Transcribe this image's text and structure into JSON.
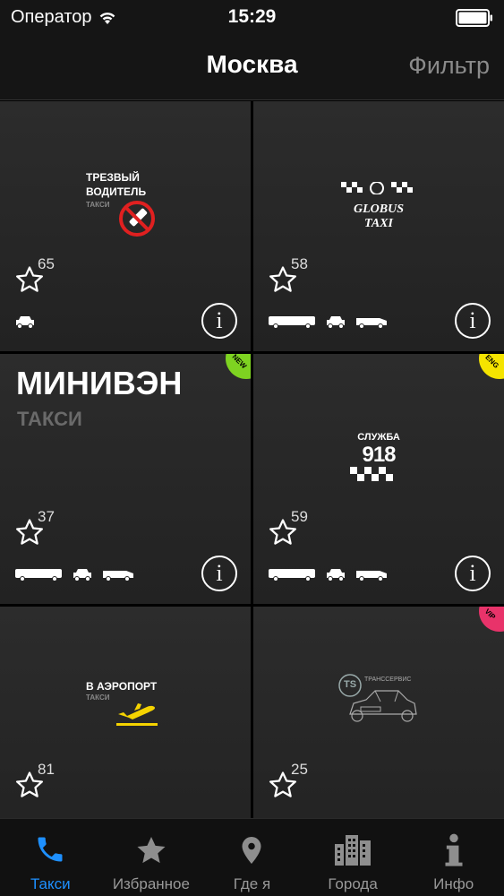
{
  "status_bar": {
    "carrier": "Оператор",
    "time": "15:29"
  },
  "nav": {
    "title": "Москва",
    "filter_label": "Фильтр"
  },
  "tiles": [
    {
      "logo_line1": "ТРЕЗВЫЙ",
      "logo_line2": "ВОДИТЕЛЬ",
      "logo_sub": "ТАКСИ",
      "rating": "65",
      "badge": ""
    },
    {
      "logo_line1": "GLOBUS",
      "logo_line2": "TAXI",
      "rating": "58",
      "badge": ""
    },
    {
      "logo_line1": "МИНИВЭН",
      "logo_sub": "ТАКСИ",
      "rating": "37",
      "badge": "NEW"
    },
    {
      "logo_line1": "СЛУЖБА",
      "logo_line2": "918",
      "rating": "59",
      "badge": "ENG"
    },
    {
      "logo_line1": "В АЭРОПОРТ",
      "logo_sub": "ТАКСИ",
      "rating": "81",
      "badge": ""
    },
    {
      "logo_line1": "ТРАНССЕРВИС",
      "logo_line2": "TS",
      "rating": "25",
      "badge": "VIP"
    }
  ],
  "colors": {
    "accent": "#1e90ff",
    "badge_new": "#7ed321",
    "badge_eng": "#f5e400",
    "badge_vip": "#e8336a",
    "plane": "#f5d300"
  },
  "tab_bar": [
    {
      "label": "Такси",
      "icon": "phone-icon",
      "active": true
    },
    {
      "label": "Избранное",
      "icon": "star-icon",
      "active": false
    },
    {
      "label": "Где я",
      "icon": "location-pin-icon",
      "active": false
    },
    {
      "label": "Города",
      "icon": "city-buildings-icon",
      "active": false
    },
    {
      "label": "Инфо",
      "icon": "info-icon",
      "active": false
    }
  ]
}
